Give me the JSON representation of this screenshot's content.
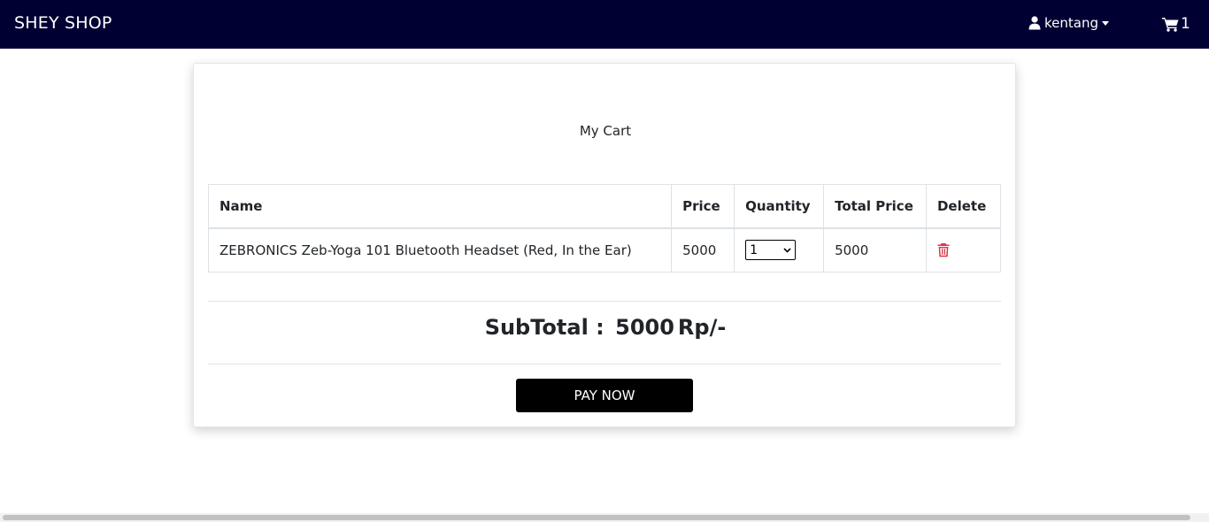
{
  "navbar": {
    "brand": "SHEY SHOP",
    "username": "kentang",
    "cart_count": "1",
    "bg_color": "#000033",
    "icons": {
      "user": "user-icon",
      "cart": "shopping-cart-icon",
      "dropdown": "caret-down-icon"
    }
  },
  "cart": {
    "title": "My Cart",
    "columns": [
      "Name",
      "Price",
      "Quantity",
      "Total Price",
      "Delete"
    ],
    "items": [
      {
        "name": "ZEBRONICS Zeb-Yoga 101 Bluetooth Headset (Red, In the Ear)",
        "price": "5000",
        "quantity": "1",
        "total": "5000",
        "delete_icon": "trash-icon",
        "delete_color": "#dc3545"
      }
    ],
    "subtotal_label": "SubTotal :",
    "subtotal_value": "5000",
    "currency": "Rp/-",
    "pay_label": "PAY NOW"
  }
}
